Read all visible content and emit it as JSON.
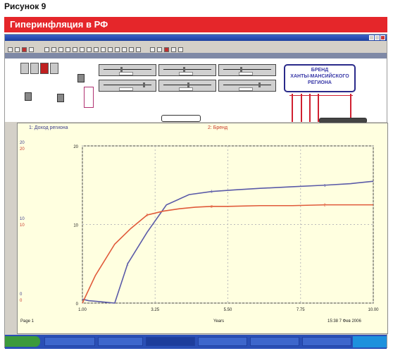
{
  "figure": {
    "title": "Рисунок 9"
  },
  "banner": {
    "title": "Гиперинфляция в РФ"
  },
  "brand_box": {
    "line1": "БРЕНД",
    "line2": "ХАНТЫ-МАНСИЙСКОГО",
    "line3": "РЕГИОНА"
  },
  "graph": {
    "legend1": "1: Доход региона",
    "legend2": "2: Бренд",
    "left_ticks": [
      "20",
      "10",
      "0"
    ],
    "left_ticks_red": [
      "20",
      "10",
      "0"
    ],
    "page_label": "Page 1",
    "xlabel": "Years",
    "timestamp": "15:38  7 Фев 2006"
  },
  "chart_data": {
    "type": "line",
    "xlabel": "Years",
    "x_ticks": [
      "1.00",
      "3.25",
      "5.50",
      "7.75",
      "10.00"
    ],
    "xlim": [
      1.0,
      10.0
    ],
    "y_ticks": [
      "0",
      "10",
      "20"
    ],
    "ylim": [
      0,
      20
    ],
    "series": [
      {
        "name": "1: Доход региона",
        "color": "#5a5aa8",
        "x": [
          1.0,
          1.2,
          1.5,
          2.0,
          2.4,
          3.0,
          3.6,
          4.3,
          5.0,
          5.7,
          6.5,
          7.5,
          8.5,
          9.3,
          10.0
        ],
        "y": [
          0.5,
          0.3,
          0.2,
          0.0,
          5.0,
          9.0,
          12.5,
          13.8,
          14.2,
          14.4,
          14.6,
          14.8,
          15.0,
          15.2,
          15.5
        ]
      },
      {
        "name": "2: Бренд",
        "color": "#e05a3a",
        "x": [
          1.0,
          1.4,
          2.0,
          2.5,
          3.0,
          3.5,
          4.0,
          4.5,
          5.0,
          5.5,
          6.5,
          7.5,
          8.5,
          9.3,
          10.0
        ],
        "y": [
          0.0,
          3.5,
          7.5,
          9.5,
          11.2,
          11.7,
          12.0,
          12.2,
          12.3,
          12.3,
          12.4,
          12.4,
          12.5,
          12.5,
          12.5
        ]
      }
    ]
  }
}
